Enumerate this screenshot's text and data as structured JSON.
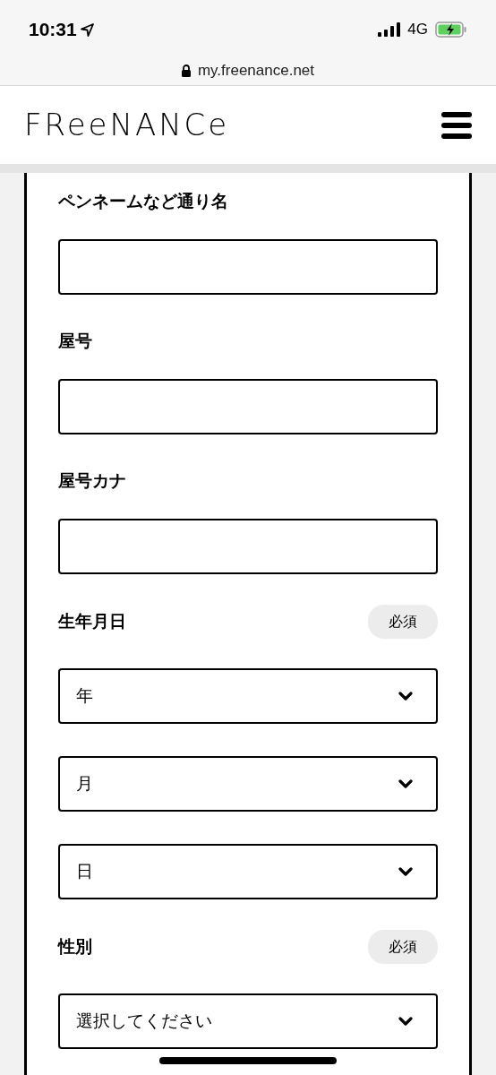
{
  "status_bar": {
    "time": "10:31",
    "network": "4G",
    "battery_charging": true
  },
  "browser": {
    "url": "my.freenance.net",
    "secure": true
  },
  "header": {
    "logo": "FReeNANCe"
  },
  "form": {
    "fields": [
      {
        "label": "ペンネームなど通り名",
        "required": false,
        "kind": "text"
      },
      {
        "label": "屋号",
        "required": false,
        "kind": "text"
      },
      {
        "label": "屋号カナ",
        "required": false,
        "kind": "text"
      },
      {
        "label": "生年月日",
        "required": true,
        "required_label": "必須",
        "kind": "select",
        "selects": [
          "年",
          "月",
          "日"
        ]
      },
      {
        "label": "性別",
        "required": true,
        "required_label": "必須",
        "kind": "select",
        "selects": [
          "選択してください"
        ]
      }
    ]
  }
}
